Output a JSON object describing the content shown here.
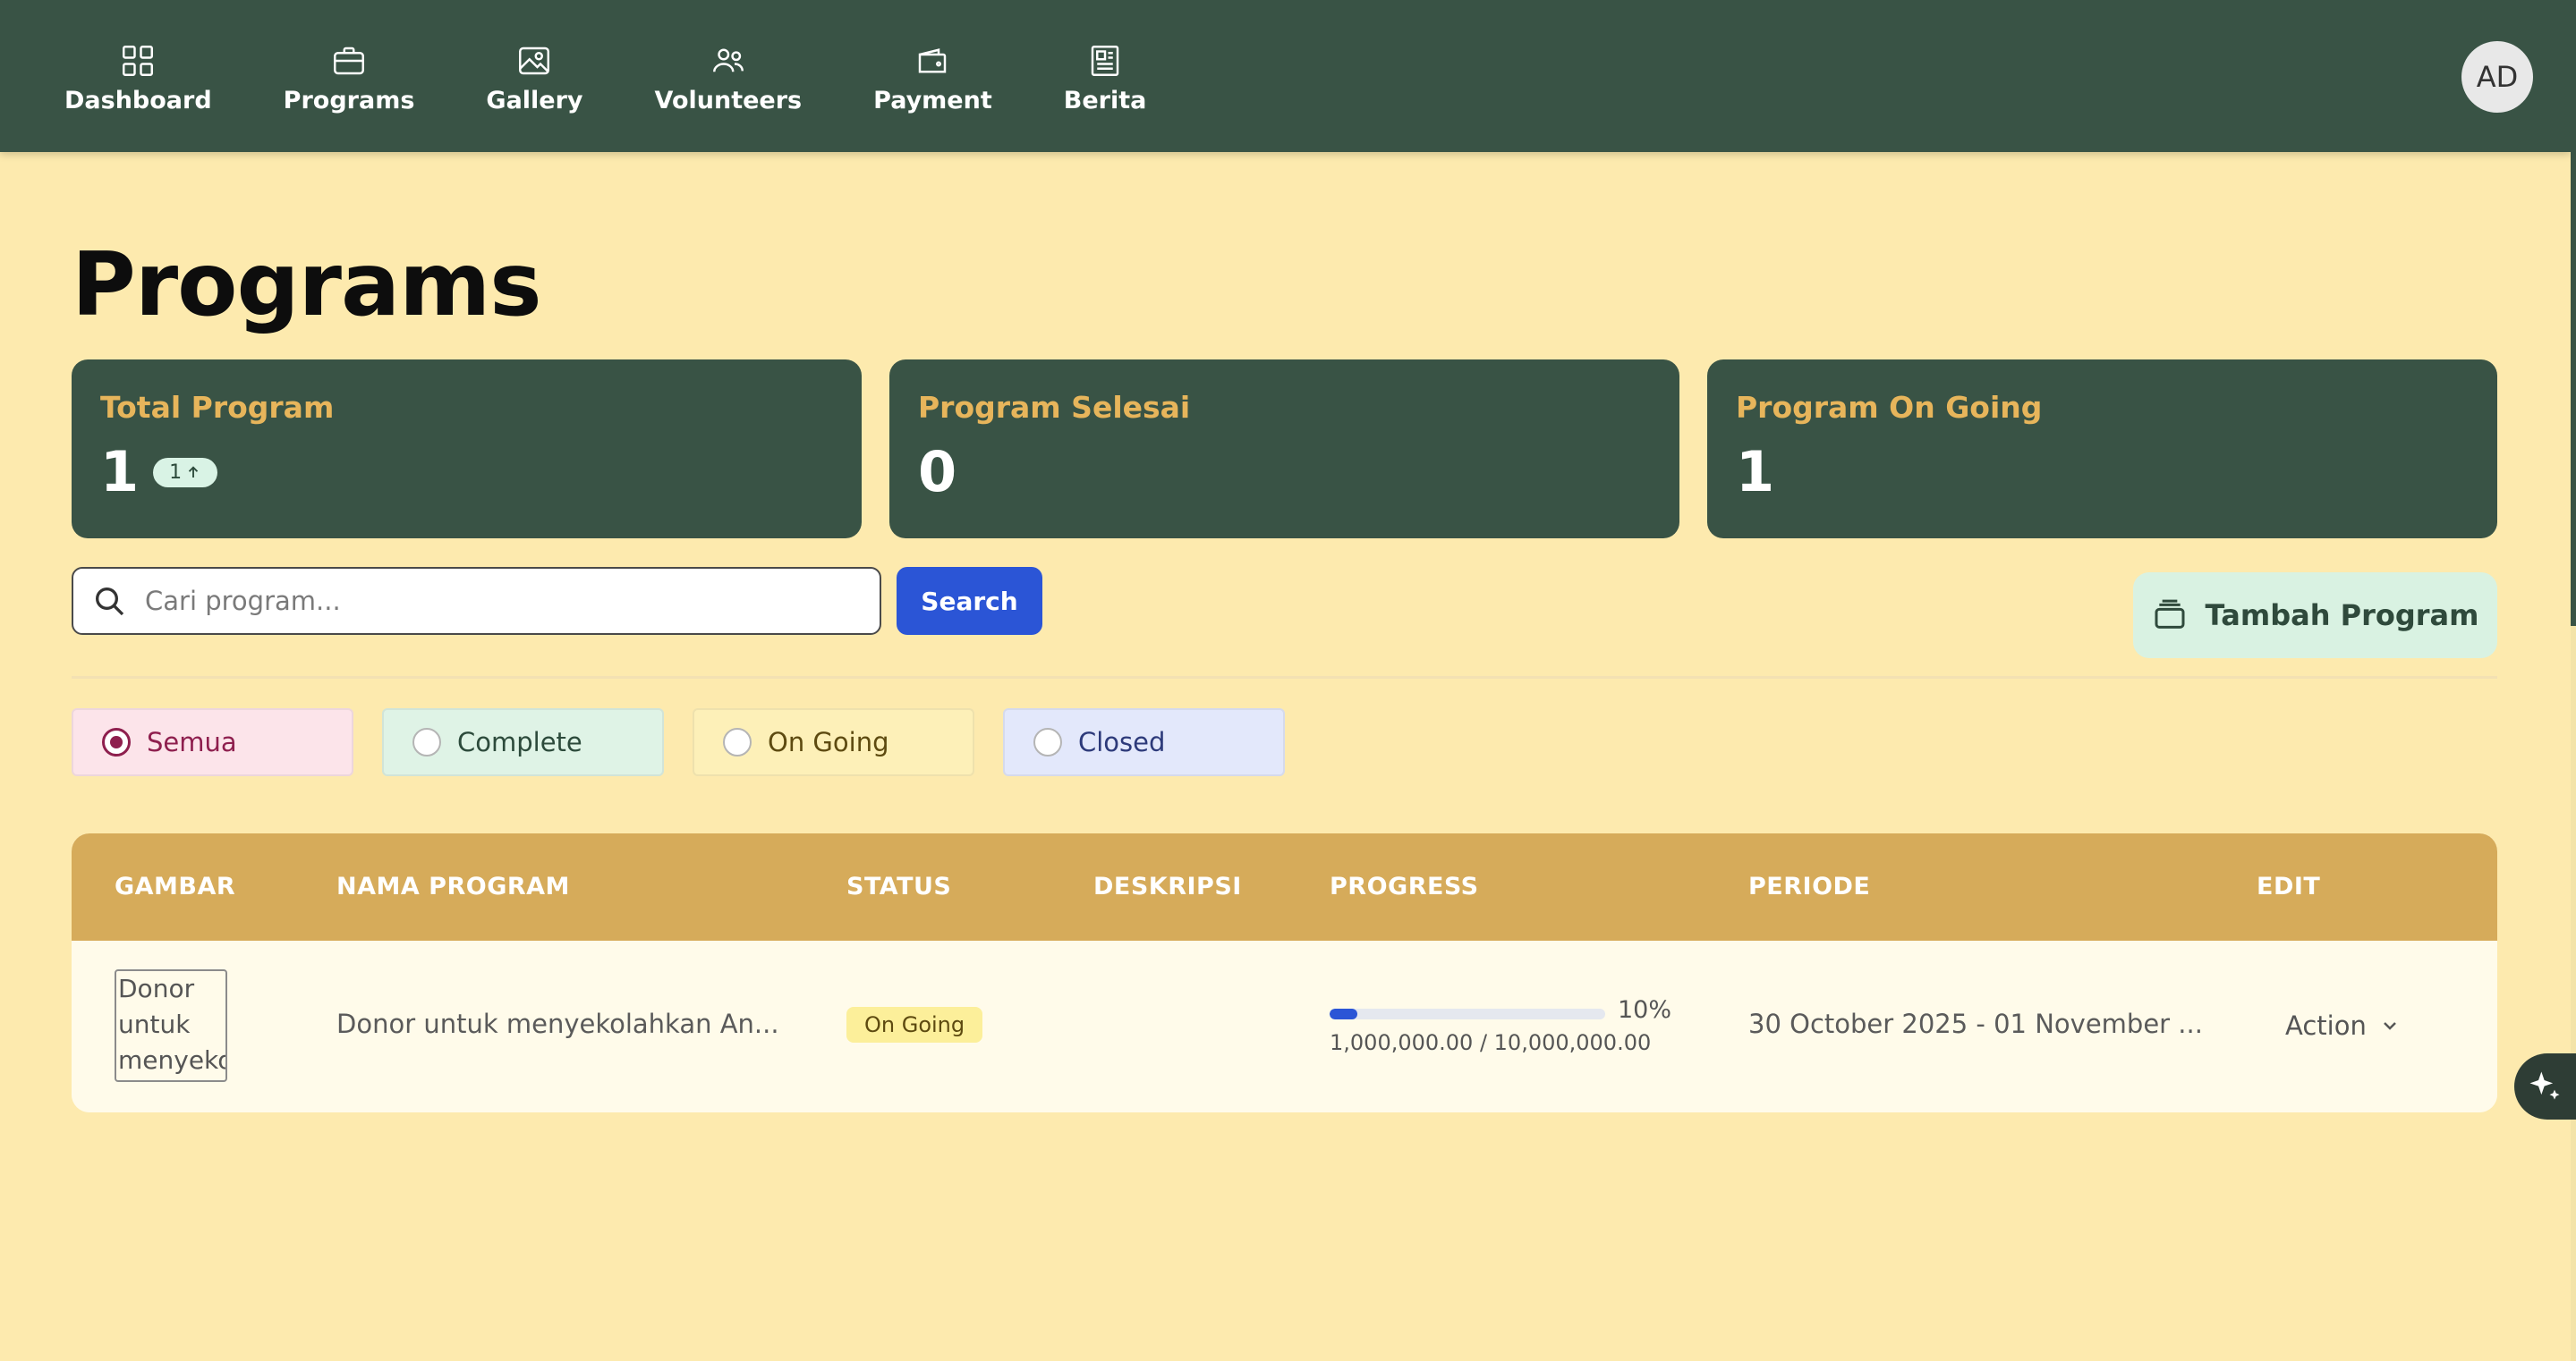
{
  "nav": {
    "items": [
      {
        "label": "Dashboard",
        "icon": "grid-icon"
      },
      {
        "label": "Programs",
        "icon": "briefcase-icon"
      },
      {
        "label": "Gallery",
        "icon": "image-icon"
      },
      {
        "label": "Volunteers",
        "icon": "users-icon"
      },
      {
        "label": "Payment",
        "icon": "wallet-icon"
      },
      {
        "label": "Berita",
        "icon": "newspaper-icon"
      }
    ],
    "avatar": "AD"
  },
  "page": {
    "title": "Programs"
  },
  "stats": [
    {
      "title": "Total Program",
      "value": "1",
      "badge": "1"
    },
    {
      "title": "Program Selesai",
      "value": "0"
    },
    {
      "title": "Program On Going",
      "value": "1"
    }
  ],
  "search": {
    "placeholder": "Cari program...",
    "button": "Search",
    "value": ""
  },
  "add_button": "Tambah Program",
  "filters": [
    {
      "label": "Semua",
      "checked": true,
      "bg": "#fce4ea",
      "color": "#8e1f4e"
    },
    {
      "label": "Complete",
      "checked": false,
      "bg": "#dff3e6",
      "color": "#2c4a3b"
    },
    {
      "label": "On Going",
      "checked": false,
      "bg": "#fdf0b8",
      "color": "#5d4a10"
    },
    {
      "label": "Closed",
      "checked": false,
      "bg": "#e3e8fb",
      "color": "#2d3a7a"
    }
  ],
  "table": {
    "headers": [
      "GAMBAR",
      "NAMA PROGRAM",
      "STATUS",
      "DESKRIPSI",
      "PROGRESS",
      "PERIODE",
      "EDIT"
    ],
    "rows": [
      {
        "image_alt": "Donor untuk menyeko",
        "name": "Donor untuk menyekolahkan An...",
        "status": "On Going",
        "description": "",
        "progress_pct": 10,
        "progress_label": "10%",
        "progress_amount": "1,000,000.00 / 10,000,000.00",
        "period": "30 October 2025 - 01 November ...",
        "action": "Action"
      }
    ]
  },
  "colors": {
    "navbar": "#395345",
    "background": "#fdeaae",
    "table_header": "#d6ab5a",
    "accent_blue": "#2b55d6",
    "stat_title": "#e7b55b"
  }
}
